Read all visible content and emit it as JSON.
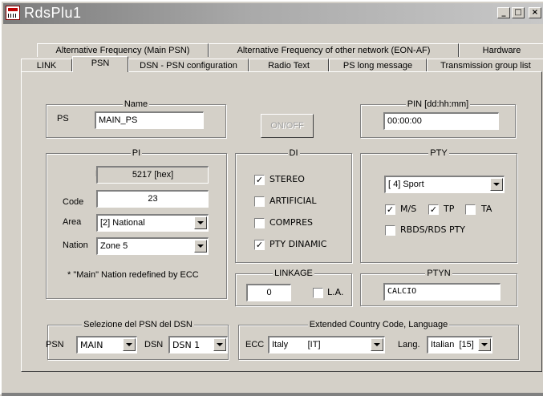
{
  "window": {
    "title": "RdsPlu1"
  },
  "titlebar_buttons": {
    "minimize": "_",
    "maximize": "□",
    "close": "×"
  },
  "tabs_row1": [
    "Alternative Frequency (Main PSN)",
    "Alternative Frequency of other network (EON-AF)",
    "Hardware"
  ],
  "tabs_row2": [
    "LINK",
    "PSN",
    "DSN - PSN configuration",
    "Radio Text",
    "PS long message",
    "Transmission group list"
  ],
  "active_tab": "PSN",
  "name_group": {
    "legend": "Name",
    "ps_label": "PS",
    "ps_value": "MAIN_PS"
  },
  "onoff_button": "ON/OFF",
  "pin_group": {
    "legend": "PIN [dd:hh:mm]",
    "value": "00:00:00"
  },
  "pi_group": {
    "legend": "PI",
    "pi_label": "PI",
    "pi_value": "5217 [hex]",
    "code_label": "Code",
    "code_value": "23",
    "area_label": "Area",
    "area_value": "[2] National",
    "nation_label": "Nation",
    "nation_value": "Zone 5",
    "note": "* \"Main\" Nation redefined by ECC"
  },
  "di_group": {
    "legend": "DI",
    "items": [
      {
        "label": "STEREO",
        "checked": true
      },
      {
        "label": "ARTIFICIAL",
        "checked": false
      },
      {
        "label": "COMPRES",
        "checked": false
      },
      {
        "label": "PTY DINAMIC",
        "checked": true
      }
    ]
  },
  "pty_group": {
    "legend": "PTY",
    "value": "[ 4] Sport",
    "ms_label": "M/S",
    "ms_checked": true,
    "tp_label": "TP",
    "tp_checked": true,
    "ta_label": "TA",
    "ta_checked": false,
    "rbds_label": "RBDS/RDS PTY",
    "rbds_checked": false
  },
  "linkage_group": {
    "legend": "LINKAGE",
    "value": "0",
    "la_label": "L.A.",
    "la_checked": false
  },
  "ptyn_group": {
    "legend": "PTYN",
    "value": "CALCIO"
  },
  "selezione_group": {
    "legend": "Selezione del PSN del  DSN",
    "psn_label": "PSN",
    "psn_value": "MAIN",
    "dsn_label": "DSN",
    "dsn_value": "DSN 1"
  },
  "ecc_group": {
    "legend": "Extended Country Code,  Language",
    "ecc_label": "ECC",
    "ecc_value": "Italy        [IT]",
    "lang_label": "Lang.",
    "lang_value": "Italian  [15]"
  },
  "check_mark": "✓"
}
